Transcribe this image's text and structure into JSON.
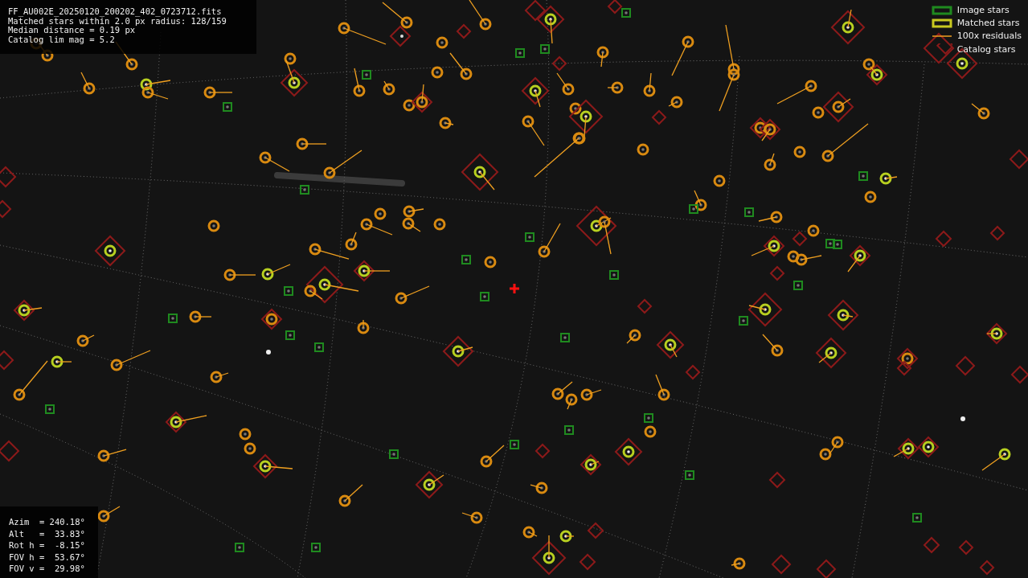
{
  "header": {
    "lines": [
      "FF_AU002E_20250120_200202_402_0723712.fits",
      "Matched stars within 2.0 px radius: 128/159",
      "Median distance = 0.19 px",
      "Catalog lim mag = 5.2"
    ]
  },
  "legend": [
    {
      "kind": "image",
      "label": "Image stars"
    },
    {
      "kind": "matched",
      "label": "Matched stars"
    },
    {
      "kind": "residual",
      "label": "100x residuals"
    },
    {
      "kind": "catalog",
      "label": "Catalog stars"
    }
  ],
  "pointing": {
    "lines": [
      "Azim  = 240.18°",
      "Alt   =  33.83°",
      "Rot h =  -8.15°",
      "FOV h =  53.67°",
      "FOV v =  29.98°"
    ]
  }
}
